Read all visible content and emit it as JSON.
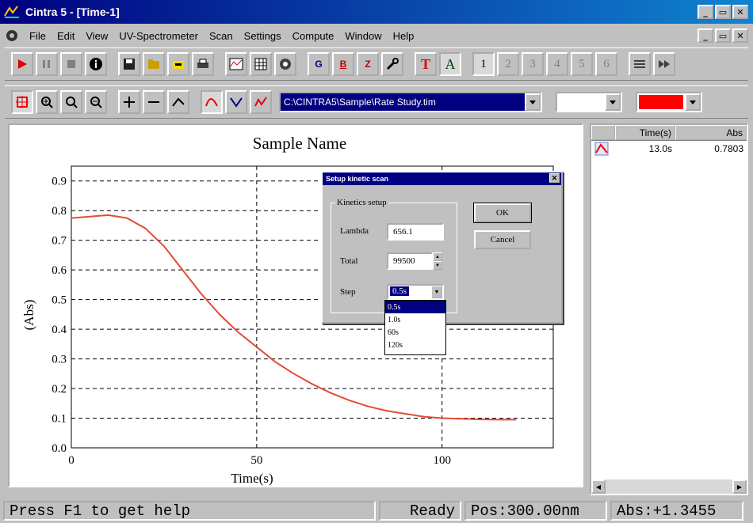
{
  "window": {
    "title": "Cintra 5 - [Time-1]"
  },
  "menu": [
    "File",
    "Edit",
    "View",
    "UV-Spectrometer",
    "Scan",
    "Settings",
    "Compute",
    "Window",
    "Help"
  ],
  "toolbar1": {
    "letter_buttons": [
      "G",
      "B",
      "Z",
      "T",
      "A"
    ],
    "cell_buttons": [
      "1",
      "2",
      "3",
      "4",
      "5",
      "6"
    ]
  },
  "toolbar2": {
    "file_path": "C:\\CINTRA5\\Sample\\Rate Study.tim",
    "line_color": "#ff0000"
  },
  "chart_data": {
    "type": "line",
    "title": "Sample Name",
    "xlabel": "Time(s)",
    "ylabel": "(Abs)",
    "xlim": [
      0,
      130
    ],
    "ylim": [
      0.0,
      0.95
    ],
    "x_ticks": [
      "0",
      "50",
      "100"
    ],
    "y_ticks": [
      "0.0",
      "0.1",
      "0.2",
      "0.3",
      "0.4",
      "0.5",
      "0.6",
      "0.7",
      "0.8",
      "0.9"
    ],
    "grid": true,
    "series": [
      {
        "color": "#e64a33",
        "x": [
          0,
          5,
          10,
          15,
          20,
          25,
          30,
          35,
          40,
          45,
          50,
          55,
          60,
          65,
          70,
          75,
          80,
          85,
          90,
          95,
          100,
          105,
          110,
          115,
          120
        ],
        "y": [
          0.775,
          0.78,
          0.785,
          0.775,
          0.74,
          0.68,
          0.6,
          0.52,
          0.45,
          0.39,
          0.34,
          0.29,
          0.25,
          0.215,
          0.185,
          0.16,
          0.14,
          0.125,
          0.115,
          0.105,
          0.1,
          0.098,
          0.096,
          0.095,
          0.095
        ]
      }
    ]
  },
  "side_table": {
    "headers": [
      "Time(s)",
      "Abs"
    ],
    "rows": [
      {
        "time": "13.0s",
        "abs": "0.7803"
      }
    ]
  },
  "statusbar": {
    "help": "Press F1 to get help",
    "state": "Ready",
    "pos": "Pos:300.00nm",
    "abs": "Abs:+1.3455"
  },
  "dialog": {
    "title": "Setup kinetic scan",
    "group_title": "Kinetics setup",
    "lambda_label": "Lambda",
    "lambda_value": "656.1",
    "total_label": "Total",
    "total_value": "99500",
    "step_label": "Step",
    "step_value": "0.5s",
    "ok_label": "OK",
    "cancel_label": "Cancel",
    "step_options": [
      "0.5s",
      "1.0s",
      "60s",
      "120s"
    ]
  }
}
